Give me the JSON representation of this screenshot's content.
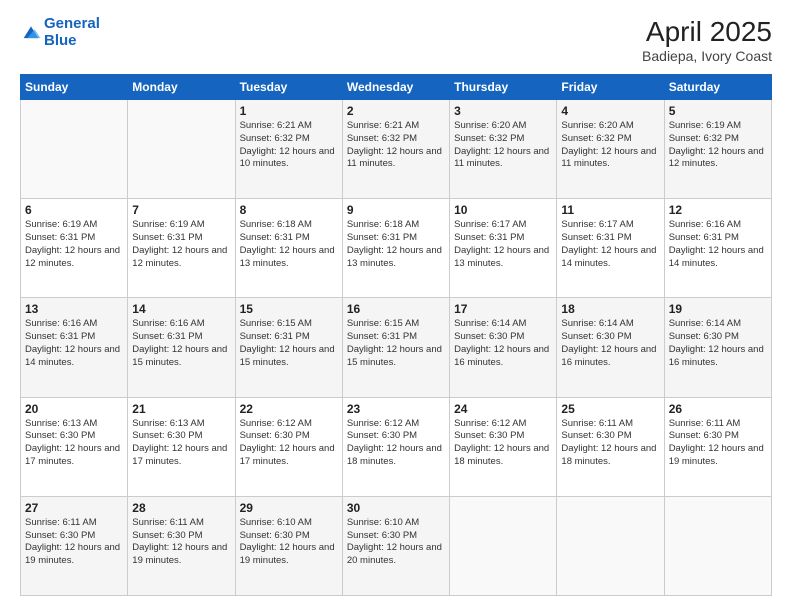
{
  "header": {
    "logo_line1": "General",
    "logo_line2": "Blue",
    "title": "April 2025",
    "subtitle": "Badiepa, Ivory Coast"
  },
  "calendar": {
    "days_of_week": [
      "Sunday",
      "Monday",
      "Tuesday",
      "Wednesday",
      "Thursday",
      "Friday",
      "Saturday"
    ],
    "weeks": [
      [
        {
          "day": "",
          "info": ""
        },
        {
          "day": "",
          "info": ""
        },
        {
          "day": "1",
          "info": "Sunrise: 6:21 AM\nSunset: 6:32 PM\nDaylight: 12 hours and 10 minutes."
        },
        {
          "day": "2",
          "info": "Sunrise: 6:21 AM\nSunset: 6:32 PM\nDaylight: 12 hours and 11 minutes."
        },
        {
          "day": "3",
          "info": "Sunrise: 6:20 AM\nSunset: 6:32 PM\nDaylight: 12 hours and 11 minutes."
        },
        {
          "day": "4",
          "info": "Sunrise: 6:20 AM\nSunset: 6:32 PM\nDaylight: 12 hours and 11 minutes."
        },
        {
          "day": "5",
          "info": "Sunrise: 6:19 AM\nSunset: 6:32 PM\nDaylight: 12 hours and 12 minutes."
        }
      ],
      [
        {
          "day": "6",
          "info": "Sunrise: 6:19 AM\nSunset: 6:31 PM\nDaylight: 12 hours and 12 minutes."
        },
        {
          "day": "7",
          "info": "Sunrise: 6:19 AM\nSunset: 6:31 PM\nDaylight: 12 hours and 12 minutes."
        },
        {
          "day": "8",
          "info": "Sunrise: 6:18 AM\nSunset: 6:31 PM\nDaylight: 12 hours and 13 minutes."
        },
        {
          "day": "9",
          "info": "Sunrise: 6:18 AM\nSunset: 6:31 PM\nDaylight: 12 hours and 13 minutes."
        },
        {
          "day": "10",
          "info": "Sunrise: 6:17 AM\nSunset: 6:31 PM\nDaylight: 12 hours and 13 minutes."
        },
        {
          "day": "11",
          "info": "Sunrise: 6:17 AM\nSunset: 6:31 PM\nDaylight: 12 hours and 14 minutes."
        },
        {
          "day": "12",
          "info": "Sunrise: 6:16 AM\nSunset: 6:31 PM\nDaylight: 12 hours and 14 minutes."
        }
      ],
      [
        {
          "day": "13",
          "info": "Sunrise: 6:16 AM\nSunset: 6:31 PM\nDaylight: 12 hours and 14 minutes."
        },
        {
          "day": "14",
          "info": "Sunrise: 6:16 AM\nSunset: 6:31 PM\nDaylight: 12 hours and 15 minutes."
        },
        {
          "day": "15",
          "info": "Sunrise: 6:15 AM\nSunset: 6:31 PM\nDaylight: 12 hours and 15 minutes."
        },
        {
          "day": "16",
          "info": "Sunrise: 6:15 AM\nSunset: 6:31 PM\nDaylight: 12 hours and 15 minutes."
        },
        {
          "day": "17",
          "info": "Sunrise: 6:14 AM\nSunset: 6:30 PM\nDaylight: 12 hours and 16 minutes."
        },
        {
          "day": "18",
          "info": "Sunrise: 6:14 AM\nSunset: 6:30 PM\nDaylight: 12 hours and 16 minutes."
        },
        {
          "day": "19",
          "info": "Sunrise: 6:14 AM\nSunset: 6:30 PM\nDaylight: 12 hours and 16 minutes."
        }
      ],
      [
        {
          "day": "20",
          "info": "Sunrise: 6:13 AM\nSunset: 6:30 PM\nDaylight: 12 hours and 17 minutes."
        },
        {
          "day": "21",
          "info": "Sunrise: 6:13 AM\nSunset: 6:30 PM\nDaylight: 12 hours and 17 minutes."
        },
        {
          "day": "22",
          "info": "Sunrise: 6:12 AM\nSunset: 6:30 PM\nDaylight: 12 hours and 17 minutes."
        },
        {
          "day": "23",
          "info": "Sunrise: 6:12 AM\nSunset: 6:30 PM\nDaylight: 12 hours and 18 minutes."
        },
        {
          "day": "24",
          "info": "Sunrise: 6:12 AM\nSunset: 6:30 PM\nDaylight: 12 hours and 18 minutes."
        },
        {
          "day": "25",
          "info": "Sunrise: 6:11 AM\nSunset: 6:30 PM\nDaylight: 12 hours and 18 minutes."
        },
        {
          "day": "26",
          "info": "Sunrise: 6:11 AM\nSunset: 6:30 PM\nDaylight: 12 hours and 19 minutes."
        }
      ],
      [
        {
          "day": "27",
          "info": "Sunrise: 6:11 AM\nSunset: 6:30 PM\nDaylight: 12 hours and 19 minutes."
        },
        {
          "day": "28",
          "info": "Sunrise: 6:11 AM\nSunset: 6:30 PM\nDaylight: 12 hours and 19 minutes."
        },
        {
          "day": "29",
          "info": "Sunrise: 6:10 AM\nSunset: 6:30 PM\nDaylight: 12 hours and 19 minutes."
        },
        {
          "day": "30",
          "info": "Sunrise: 6:10 AM\nSunset: 6:30 PM\nDaylight: 12 hours and 20 minutes."
        },
        {
          "day": "",
          "info": ""
        },
        {
          "day": "",
          "info": ""
        },
        {
          "day": "",
          "info": ""
        }
      ]
    ]
  }
}
